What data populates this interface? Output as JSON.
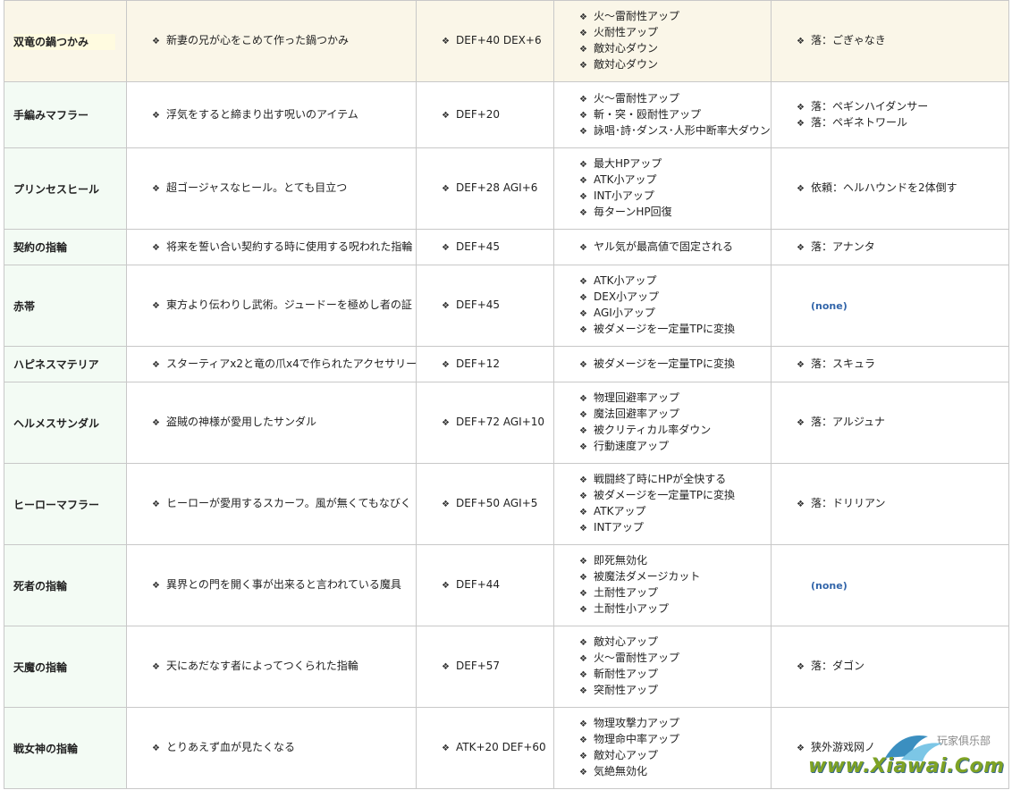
{
  "rows": [
    {
      "name": "双竜の鍋つかみ",
      "desc": "新妻の兄が心をこめて作った鍋つかみ",
      "stat": "DEF+40 DEX+6",
      "effects": [
        "火～雷耐性アップ",
        "火耐性アップ",
        "敵対心ダウン",
        "敵対心ダウン"
      ],
      "source": [
        "落：ごぎゃなき"
      ]
    },
    {
      "name": "手編みマフラー",
      "desc": "浮気をすると締まり出す呪いのアイテム",
      "stat": "DEF+20",
      "effects": [
        "火～雷耐性アップ",
        "斬・突・殴耐性アップ",
        "詠唱･詩･ダンス･人形中断率大ダウン"
      ],
      "source": [
        "落：ペギンハイダンサー",
        "落：ペギネトワール"
      ]
    },
    {
      "name": "プリンセスヒール",
      "desc": "超ゴージャスなヒール。とても目立つ",
      "stat": "DEF+28 AGI+6",
      "effects": [
        "最大HPアップ",
        "ATK小アップ",
        "INT小アップ",
        "毎ターンHP回復"
      ],
      "source": [
        "依頼：ヘルハウンドを2体倒す"
      ]
    },
    {
      "name": "契約の指輪",
      "desc": "将来を誓い合い契約する時に使用する呪われた指輪",
      "stat": "DEF+45",
      "effects": [
        "ヤル気が最高値で固定される"
      ],
      "source": [
        "落：アナンタ"
      ]
    },
    {
      "name": "赤帯",
      "desc": "東方より伝わりし武術。ジュードーを極めし者の証",
      "stat": "DEF+45",
      "effects": [
        "ATK小アップ",
        "DEX小アップ",
        "AGI小アップ",
        "被ダメージを一定量TPに変換"
      ],
      "source": [],
      "none": "(none)"
    },
    {
      "name": "ハピネスマテリア",
      "desc": "スターティアx2と竜の爪x4で作られたアクセサリー",
      "stat": "DEF+12",
      "effects": [
        "被ダメージを一定量TPに変換"
      ],
      "source": [
        "落：スキュラ"
      ]
    },
    {
      "name": "ヘルメスサンダル",
      "desc": "盗賊の神様が愛用したサンダル",
      "stat": "DEF+72 AGI+10",
      "effects": [
        "物理回避率アップ",
        "魔法回避率アップ",
        "被クリティカル率ダウン",
        "行動速度アップ"
      ],
      "source": [
        "落：アルジュナ"
      ]
    },
    {
      "name": "ヒーローマフラー",
      "desc": "ヒーローが愛用するスカーフ。風が無くてもなびく",
      "stat": "DEF+50 AGI+5",
      "effects": [
        "戦闘終了時にHPが全快する",
        "被ダメージを一定量TPに変換",
        "ATKアップ",
        "INTアップ"
      ],
      "source": [
        "落：ドリリアン"
      ]
    },
    {
      "name": "死者の指輪",
      "desc": "異界との門を開く事が出来ると言われている魔具",
      "stat": "DEF+44",
      "effects": [
        "即死無効化",
        "被魔法ダメージカット",
        "土耐性アップ",
        "土耐性小アップ"
      ],
      "source": [],
      "none": "(none)"
    },
    {
      "name": "天魔の指輪",
      "desc": "天にあだなす者によってつくられた指輪",
      "stat": "DEF+57",
      "effects": [
        "敵対心アップ",
        "火～雷耐性アップ",
        "斬耐性アップ",
        "突耐性アップ"
      ],
      "source": [
        "落：ダゴン"
      ]
    },
    {
      "name": "戦女神の指輪",
      "desc": "とりあえず血が見たくなる",
      "stat": "ATK+20 DEF+60",
      "effects": [
        "物理攻撃力アップ",
        "物理命中率アップ",
        "敵対心アップ",
        "気絶無効化"
      ],
      "source": [
        "狭外游戏网ノ"
      ]
    }
  ],
  "watermark": {
    "site": "www.Xiawai.Com",
    "tagline": "玩家俱乐部"
  },
  "bullet": "❖"
}
